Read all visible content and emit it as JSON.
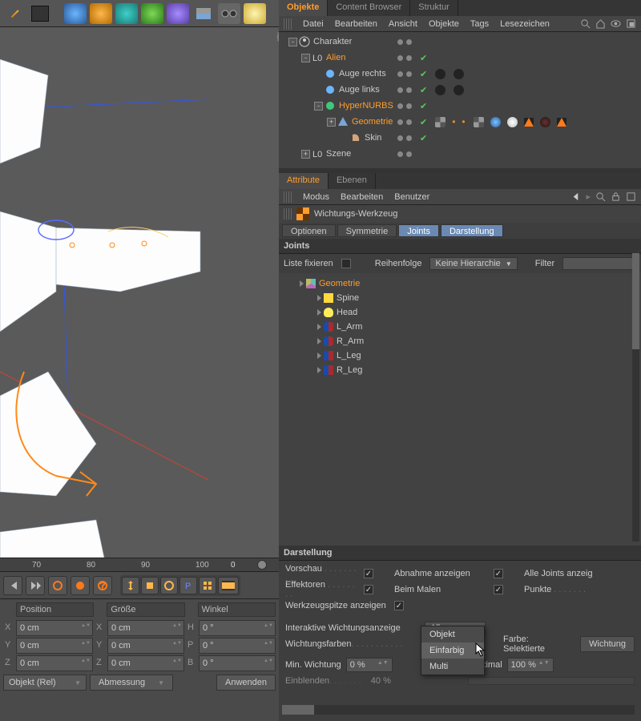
{
  "toolbar_icons": [
    "pen-icon",
    "film-icon",
    "cube-icon",
    "null-icon",
    "spline-icon",
    "generator-icon",
    "deformer-icon",
    "environment-icon",
    "camera-icon",
    "light-icon"
  ],
  "ruler": {
    "ticks": [
      "70",
      "80",
      "90",
      "100"
    ],
    "marker": "0"
  },
  "transport": [
    "goto-start",
    "prev-key",
    "record",
    "autokey",
    "keyframe-sel",
    "move-key",
    "scale-key",
    "rotate-key",
    "param-key",
    "allkeys-key",
    "anim-layer",
    "film"
  ],
  "coords": {
    "head": [
      "Position",
      "Größe",
      "Winkel"
    ],
    "rows": [
      {
        "axis": "X",
        "p": "0 cm",
        "s_lab": "X",
        "s": "0 cm",
        "w_lab": "H",
        "w": "0 °"
      },
      {
        "axis": "Y",
        "p": "0 cm",
        "s_lab": "Y",
        "s": "0 cm",
        "w_lab": "P",
        "w": "0 °"
      },
      {
        "axis": "Z",
        "p": "0 cm",
        "s_lab": "Z",
        "s": "0 cm",
        "w_lab": "B",
        "w": "0 °"
      }
    ],
    "mode": "Objekt (Rel)",
    "dim": "Abmessung",
    "apply": "Anwenden"
  },
  "obj_panel": {
    "tabs": [
      "Objekte",
      "Content Browser",
      "Struktur"
    ],
    "menu": [
      "Datei",
      "Bearbeiten",
      "Ansicht",
      "Objekte",
      "Tags",
      "Lesezeichen"
    ],
    "tree": [
      {
        "indent": 0,
        "exp": "-",
        "icon": "char",
        "label": "Charakter",
        "orange": false,
        "tags": [
          "en"
        ]
      },
      {
        "indent": 1,
        "exp": "-",
        "icon": "null",
        "label": "Alien",
        "orange": true,
        "tags": [
          "en",
          "chk"
        ]
      },
      {
        "indent": 2,
        "exp": "",
        "icon": "sphere",
        "label": "Auge rechts",
        "orange": false,
        "tags": [
          "en",
          "chk",
          "mat",
          "mat"
        ]
      },
      {
        "indent": 2,
        "exp": "",
        "icon": "sphere",
        "label": "Auge links",
        "orange": false,
        "tags": [
          "en",
          "chk",
          "mat",
          "mat"
        ]
      },
      {
        "indent": 2,
        "exp": "-",
        "icon": "hnurbs",
        "label": "HyperNURBS",
        "orange": true,
        "tags": [
          "en",
          "chk"
        ]
      },
      {
        "indent": 3,
        "exp": "+",
        "icon": "geo",
        "label": "Geometrie",
        "orange": true,
        "tags": [
          "en",
          "chk",
          "checker",
          "x",
          "x",
          "checker",
          "blue",
          "white",
          "tri",
          "dark",
          "tri"
        ]
      },
      {
        "indent": 4,
        "exp": "",
        "icon": "skin",
        "label": "Skin",
        "orange": false,
        "tags": [
          "en",
          "chk"
        ]
      },
      {
        "indent": 1,
        "exp": "+",
        "icon": "null",
        "label": "Szene",
        "orange": false,
        "tags": [
          "en"
        ]
      }
    ]
  },
  "attr_panel": {
    "tabs": [
      "Attribute",
      "Ebenen"
    ],
    "menu": [
      "Modus",
      "Bearbeiten",
      "Benutzer"
    ],
    "title": "Wichtungs-Werkzeug",
    "subtabs": [
      "Optionen",
      "Symmetrie",
      "Joints",
      "Darstellung"
    ],
    "active_subtabs": [
      "Joints",
      "Darstellung"
    ],
    "joints": {
      "head": "Joints",
      "fix": "Liste fixieren",
      "order": "Reihenfolge",
      "order_val": "Keine Hierarchie",
      "filter": "Filter",
      "root": "Geometrie",
      "items": [
        "Spine",
        "Head",
        "L_Arm",
        "R_Arm",
        "L_Leg",
        "R_Leg"
      ]
    },
    "darst": {
      "head": "Darstellung",
      "row1": [
        {
          "l": "Vorschau",
          "c": true
        },
        {
          "l": "Abnahme anzeigen",
          "c": true
        },
        {
          "l": "Alle Joints anzeig"
        }
      ],
      "row2": [
        {
          "l": "Effektoren",
          "c": true
        },
        {
          "l": "Beim Malen",
          "c": true
        },
        {
          "l": "Punkte"
        }
      ],
      "row3": "Werkzeugspitze anzeigen",
      "interactive": "Interaktive Wichtungsanzeige",
      "interactive_val": "Alle",
      "colors": "Wichtungsfarben",
      "colors_val": "Einfarbig",
      "selcolor": "Farbe: Selektierte",
      "weighting_btn": "Wichtung",
      "min": "Min. Wichtung",
      "min_v": "0 %",
      "max": "Maximal",
      "max_v": "100 %",
      "fade": "Einblenden",
      "fade_v": "40 %"
    },
    "popup": [
      "Objekt",
      "Einfarbig",
      "Multi"
    ]
  }
}
